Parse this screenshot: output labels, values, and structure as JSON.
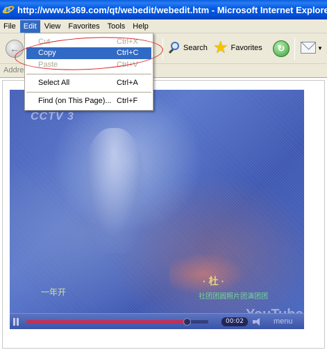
{
  "window": {
    "title": "http://www.k369.com/qt/webedit/webedit.htm - Microsoft Internet Explorer"
  },
  "menubar": {
    "items": [
      "File",
      "Edit",
      "View",
      "Favorites",
      "Tools",
      "Help"
    ]
  },
  "toolbar": {
    "search_label": "Search",
    "favorites_label": "Favorites"
  },
  "addressbar": {
    "label": "Address"
  },
  "edit_menu": {
    "cut": {
      "label": "Cut",
      "shortcut": "Ctrl+X"
    },
    "copy": {
      "label": "Copy",
      "shortcut": "Ctrl+C"
    },
    "paste": {
      "label": "Paste",
      "shortcut": "Ctrl+V"
    },
    "select_all": {
      "label": "Select All",
      "shortcut": "Ctrl+A"
    },
    "find": {
      "label": "Find (on This Page)...",
      "shortcut": "Ctrl+F"
    }
  },
  "video": {
    "channel_logo": "CCTV 3",
    "watermark": "YouTube",
    "time": "00:02",
    "menu_label": "menu",
    "progress": 0.88
  },
  "colors": {
    "titlebar": "#0054e3",
    "highlight": "#316ac5",
    "annotation": "#e02020"
  }
}
